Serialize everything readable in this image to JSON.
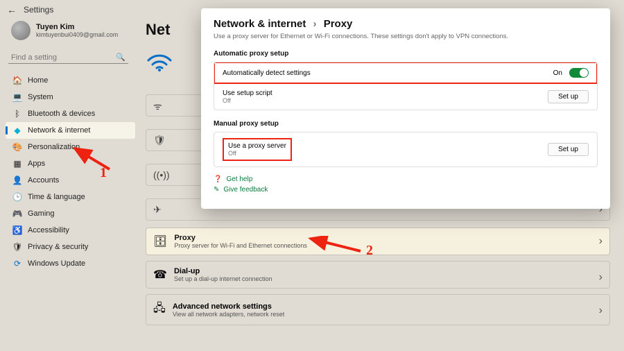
{
  "window": {
    "title": "Settings"
  },
  "profile": {
    "name": "Tuyen Kim",
    "email": "kimtuyenbui0409@gmail.com"
  },
  "search": {
    "placeholder": "Find a setting"
  },
  "nav": [
    {
      "label": "Home",
      "icon": "🏠"
    },
    {
      "label": "System",
      "icon": "💻"
    },
    {
      "label": "Bluetooth & devices",
      "icon": "ᛒ"
    },
    {
      "label": "Network & internet",
      "icon": "◆"
    },
    {
      "label": "Personalization",
      "icon": "🎨"
    },
    {
      "label": "Apps",
      "icon": "▦"
    },
    {
      "label": "Accounts",
      "icon": "👤"
    },
    {
      "label": "Time & language",
      "icon": "🕒"
    },
    {
      "label": "Gaming",
      "icon": "🎮"
    },
    {
      "label": "Accessibility",
      "icon": "♿"
    },
    {
      "label": "Privacy & security",
      "icon": "🛡"
    },
    {
      "label": "Windows Update",
      "icon": "⟳"
    }
  ],
  "main": {
    "heading_truncated": "Net",
    "proxy_card": {
      "title": "Proxy",
      "sub": "Proxy server for Wi-Fi and Ethernet connections"
    },
    "dialup": {
      "title": "Dial-up",
      "sub": "Set up a dial-up internet connection"
    },
    "advanced": {
      "title": "Advanced network settings",
      "sub": "View all network adapters, network reset"
    }
  },
  "modal": {
    "crumb_parent": "Network & internet",
    "crumb_leaf": "Proxy",
    "sub": "Use a proxy server for Ethernet or Wi-Fi connections. These settings don't apply to VPN connections.",
    "auto_section": "Automatic proxy setup",
    "auto_detect": {
      "label": "Automatically detect settings",
      "state": "On"
    },
    "setup_script": {
      "label": "Use setup script",
      "sub": "Off",
      "btn": "Set up"
    },
    "manual_section": "Manual proxy setup",
    "use_proxy": {
      "label": "Use a proxy server",
      "sub": "Off",
      "btn": "Set up"
    },
    "links": {
      "help": "Get help",
      "feedback": "Give feedback"
    }
  },
  "annotations": {
    "one": "1",
    "two": "2"
  }
}
